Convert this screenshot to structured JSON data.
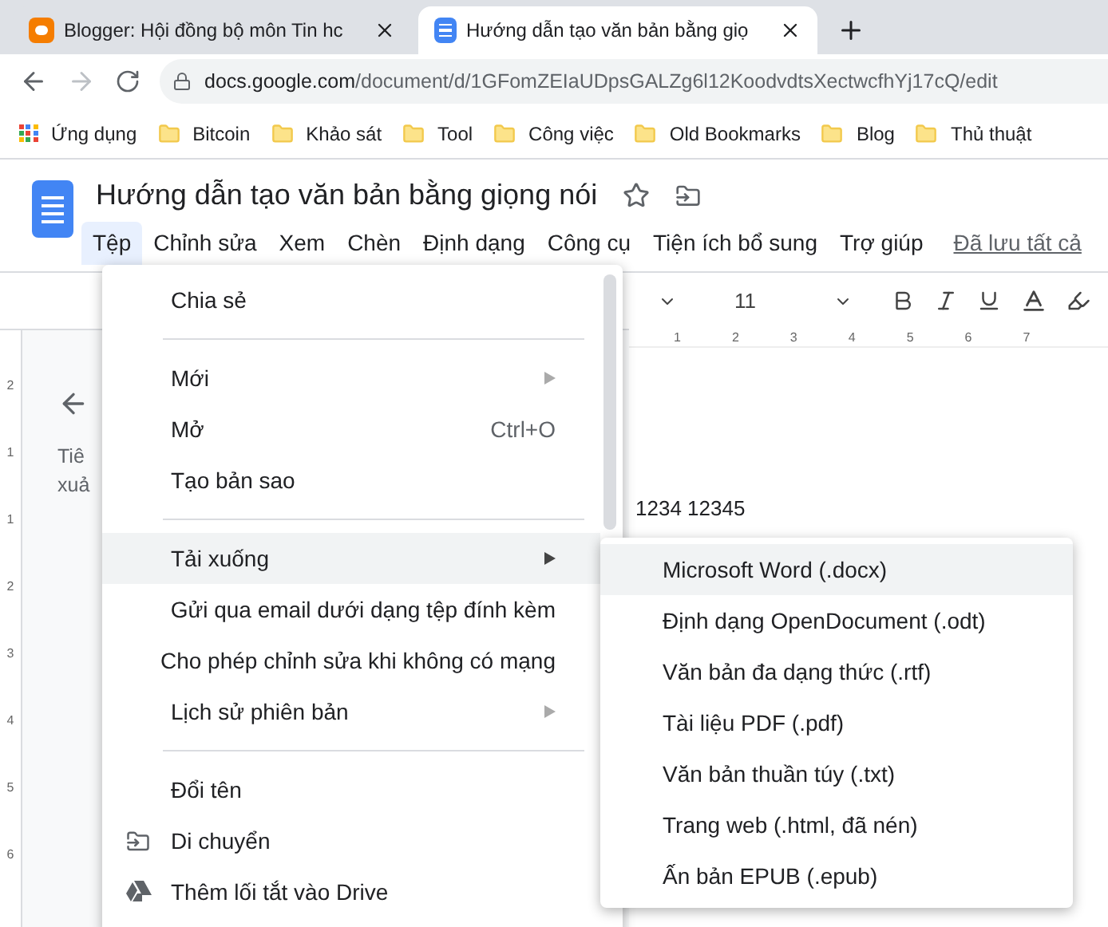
{
  "browser_tabs": [
    {
      "title": "Blogger: Hội đồng bộ môn Tin hc",
      "kind": "blogger",
      "selected": false
    },
    {
      "title": "Hướng dẫn tạo văn bản bằng giọ",
      "kind": "docs",
      "selected": true
    }
  ],
  "address_bar": {
    "host": "docs.google.com",
    "path": "/document/d/1GFomZEIaUDpsGALZg6l12KoodvdtsXectwcfhYj17cQ/edit"
  },
  "bookmarks": [
    {
      "label": "Ứng dụng",
      "kind": "apps"
    },
    {
      "label": "Bitcoin",
      "kind": "folder"
    },
    {
      "label": "Khảo sát",
      "kind": "folder"
    },
    {
      "label": "Tool",
      "kind": "folder"
    },
    {
      "label": "Công việc",
      "kind": "folder"
    },
    {
      "label": "Old Bookmarks",
      "kind": "folder"
    },
    {
      "label": "Blog",
      "kind": "folder"
    },
    {
      "label": "Thủ thuật",
      "kind": "folder"
    }
  ],
  "document": {
    "title": "Hướng dẫn tạo văn bản bằng giọng nói",
    "save_status": "Đã lưu tất cả",
    "body_text": "1234 12345",
    "outline_lines": [
      "Tiê",
      "xuả"
    ]
  },
  "menubar": [
    {
      "label": "Tệp",
      "selected": true
    },
    {
      "label": "Chỉnh sửa",
      "selected": false
    },
    {
      "label": "Xem",
      "selected": false
    },
    {
      "label": "Chèn",
      "selected": false
    },
    {
      "label": "Định dạng",
      "selected": false
    },
    {
      "label": "Công cụ",
      "selected": false
    },
    {
      "label": "Tiện ích bổ sung",
      "selected": false
    },
    {
      "label": "Trợ giúp",
      "selected": false
    }
  ],
  "toolbar": {
    "font_size": "11",
    "ruler_numbers": [
      "1",
      "2",
      "3",
      "4",
      "5",
      "6",
      "7"
    ],
    "side_ruler_numbers": [
      "2",
      "1",
      "1",
      "2",
      "3",
      "4",
      "5",
      "6"
    ]
  },
  "file_menu": [
    {
      "kind": "item",
      "label": "Chia sẻ",
      "selected": false
    },
    {
      "kind": "separator"
    },
    {
      "kind": "item",
      "label": "Mới",
      "submenu": true,
      "selected": false
    },
    {
      "kind": "item",
      "label": "Mở",
      "shortcut": "Ctrl+O",
      "selected": false
    },
    {
      "kind": "item",
      "label": "Tạo bản sao",
      "selected": false
    },
    {
      "kind": "separator"
    },
    {
      "kind": "item",
      "label": "Tải xuống",
      "submenu": true,
      "selected": true
    },
    {
      "kind": "item",
      "label": "Gửi qua email dưới dạng tệp đính kèm",
      "selected": false
    },
    {
      "kind": "item",
      "label": "Cho phép chỉnh sửa khi không có mạng",
      "selected": false
    },
    {
      "kind": "item",
      "label": "Lịch sử phiên bản",
      "submenu": true,
      "selected": false
    },
    {
      "kind": "separator"
    },
    {
      "kind": "item",
      "label": "Đổi tên",
      "selected": false
    },
    {
      "kind": "move",
      "label": "Di chuyển",
      "selected": false
    },
    {
      "kind": "drive",
      "label": "Thêm lối tắt vào Drive",
      "selected": false
    }
  ],
  "download_menu": [
    {
      "label": "Microsoft Word (.docx)",
      "selected": true
    },
    {
      "label": "Định dạng OpenDocument (.odt)",
      "selected": false
    },
    {
      "label": "Văn bản đa dạng thức (.rtf)",
      "selected": false
    },
    {
      "label": "Tài liệu PDF (.pdf)",
      "selected": false
    },
    {
      "label": "Văn bản thuần túy (.txt)",
      "selected": false
    },
    {
      "label": "Trang web (.html, đã nén)",
      "selected": false
    },
    {
      "label": "Ấn bản EPUB (.epub)",
      "selected": false
    }
  ]
}
